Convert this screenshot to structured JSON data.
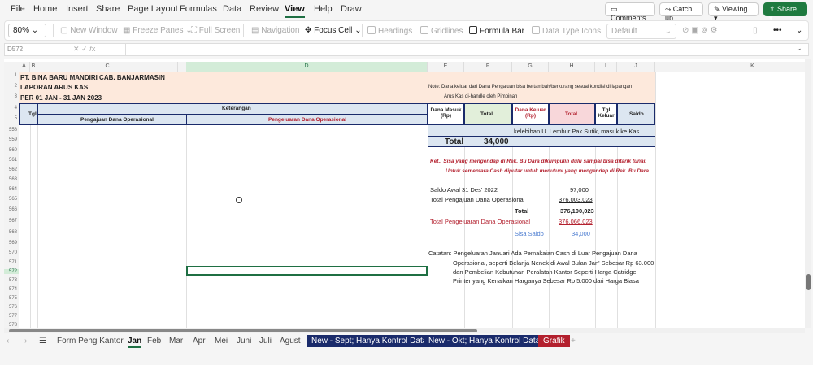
{
  "menu": {
    "items": [
      "File",
      "Home",
      "Insert",
      "Share",
      "Page Layout",
      "Formulas",
      "Data",
      "Review",
      "View",
      "Help",
      "Draw"
    ],
    "active": "View"
  },
  "top_buttons": {
    "comments": "Comments",
    "catchup": "Catch up",
    "viewing": "Viewing",
    "share": "Share"
  },
  "ribbon": {
    "zoom": "80%",
    "new_window": "New Window",
    "freeze": "Freeze Panes",
    "full": "Full Screen",
    "navigation": "Navigation",
    "focus": "Focus Cell",
    "headings": "Headings",
    "gridlines": "Gridlines",
    "formula_bar": "Formula Bar",
    "data_icons": "Data Type Icons",
    "style": "Default"
  },
  "namebox": "D572",
  "cols": [
    "A",
    "B",
    "C",
    "D",
    "E",
    "F",
    "G",
    "H",
    "I",
    "J",
    "K"
  ],
  "rows": {
    "top": [
      "1",
      "2",
      "3",
      "4",
      "5"
    ],
    "body": [
      "558",
      "559",
      "560",
      "561",
      "562",
      "563",
      "564",
      "565",
      "566",
      "567",
      "568",
      "569",
      "570",
      "571",
      "572",
      "573",
      "574",
      "575",
      "576",
      "577",
      "578"
    ]
  },
  "sheet": {
    "company": "PT. BINA BARU MANDIRI CAB. BANJARMASIN",
    "report": "LAPORAN ARUS KAS",
    "period": "PER 01 JAN - 31 JAN 2023",
    "note1": "Note:  Dana keluar dari Dana Pengajuan bisa bertambah/berkurang sesuai kondisi di lapangan",
    "note2": "Arus Kas di-handle oleh Pimpinan",
    "h_tgl": "Tgl",
    "h_ket": "Keterangan",
    "h_peng": "Pengajuan Dana Operasional",
    "h_pengel": "Pengeluaran Dana Operasional",
    "h_dm": "Dana Masuk (Rp)",
    "h_total": "Total",
    "h_dk": "Dana Keluar (Rp)",
    "h_total2": "Total",
    "h_tglk": "Tgl Keluar",
    "h_saldo": "Saldo",
    "r558": "kelebihan U. Lembur Pak Sutik, masuk ke Kas",
    "total_label": "Total",
    "total_value": "34,000",
    "ket1": "Ket.:  Sisa yang mengendap di Rek. Bu Dara dikumpulin dulu sampai bisa ditarik tunai.",
    "ket2": "Untuk sementara Cash diputar untuk menutupi yang mengendap di Rek. Bu Dara.",
    "saldo_awal": "Saldo Awal 31 Des' 2022",
    "saldo_awal_v": "97,000",
    "tot_peng": "Total Pengajuan Dana Operasional",
    "tot_peng_v": "376,003,023",
    "total_lbl2": "Total",
    "total_v2": "376,100,023",
    "tot_pengel": "Total Pengeluaran Dana Operasional",
    "tot_pengel_v": "376,066,023",
    "sisa": "Sisa Saldo",
    "sisa_v": "34,000",
    "c1": "Catatan:  Pengeluaran Januari Ada Pemakaian Cash di Luar Pengajuan Dana",
    "c2": "Operasional, seperti Belanja Nenek di Awal Bulan Jan' Sebesar Rp 63.000",
    "c3": "dan Pembelian Kebutuhan Peralatan Kantor Seperti Harga Catridge",
    "c4": "Printer yang Kenaikan Harganya Sebesar Rp 5.000 dari Harga Biasa"
  },
  "tabs": [
    "Form Peng Kantor",
    "Jan",
    "Feb",
    "Mar",
    "Apr",
    "Mei",
    "Juni",
    "Juli",
    "Agust",
    "New - Sept; Hanya Kontrol Data",
    "New - Okt; Hanya Kontrol Data",
    "Grafik"
  ],
  "tab_active": "Jan",
  "colors": {
    "accent": "#1f6f43",
    "navy": "#1a2b6b",
    "red": "#b3202e",
    "peach": "#fde9dc",
    "blue_hdr": "#dce6f1"
  }
}
